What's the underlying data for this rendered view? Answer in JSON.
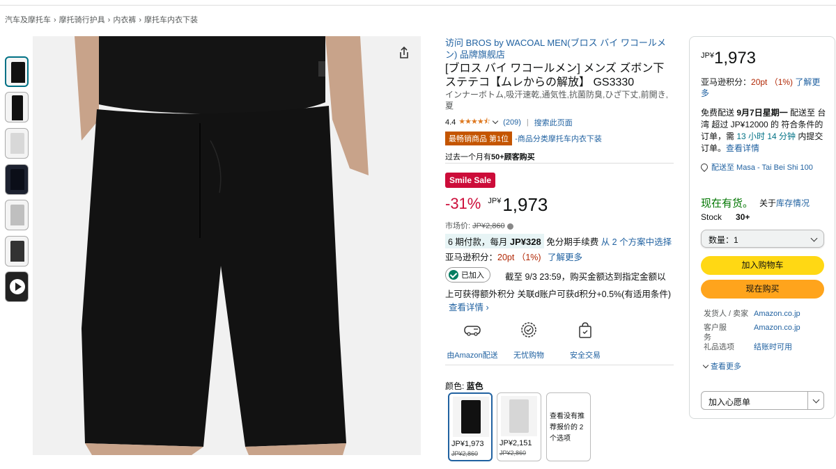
{
  "breadcrumb": [
    "汽车及摩托车",
    "摩托骑行护具",
    "内衣裤",
    "摩托车内衣下装"
  ],
  "breadcrumb_sep": "›",
  "product": {
    "brand_link": "访问 BROS by WACOAL MEN(ブロス バイ ワコールメン) 品牌旗舰店",
    "title": "[ブロス バイ ワコールメン] メンズ ズボン下 ステテコ【ムレからの解放】 GS3330",
    "subtitle": "インナーボトム,吸汗速乾,通気性,抗菌防臭,ひざ下丈,前開き,夏",
    "rating_value": "4.4",
    "stars": "★★★★⯪",
    "rating_count": "(209)",
    "rating_sep": "|",
    "search_page": "搜索此页面",
    "bestseller_badge": "最畅销商品 第1位",
    "bestseller_category": "-商品分类摩托车内衣下装",
    "bought_prefix": "过去一个月有",
    "bought_count": "50+",
    "bought_suffix": "顾客购买"
  },
  "pricing": {
    "deal_badge": "Smile Sale",
    "discount": "-31%",
    "currency": "JP¥",
    "price": "1,973",
    "list_price_label": "市场价: ",
    "list_price": "JP¥2,860",
    "installment_part1": "6 期付款，每月 ",
    "installment_amount": "JP¥328",
    "installment_part2": " 免分期手续费 ",
    "installment_link": "从 2 个方案中选择",
    "points_label": "亚马逊积分：",
    "points_value": "20pt （1%)",
    "points_link": "了解更多",
    "joined_label": "已加入",
    "promo_line1": "截至 9/3 23:59，购买金额达到指定金额以",
    "promo_line2": "上可获得额外积分 关联d账户可获d积分+0.5%(有适用条件)",
    "promo_link": "查看详情 ›"
  },
  "features": [
    {
      "label": "由Amazon配送",
      "icon": "delivery-truck-icon"
    },
    {
      "label": "无忧购物",
      "icon": "badge-check-icon"
    },
    {
      "label": "安全交易",
      "icon": "secure-bag-icon"
    }
  ],
  "color": {
    "label": "颜色: ",
    "selected": "蓝色",
    "options": [
      {
        "price": "JP¥1,973",
        "list_price": "JP¥2,860",
        "swatch": "#111111"
      },
      {
        "price": "JP¥2,151",
        "list_price": "JP¥2,860",
        "swatch": "#d6d6d6"
      }
    ],
    "more_options": "查看没有推荐报价的 2 个选项"
  },
  "buybox": {
    "currency": "JP¥",
    "price": "1,973",
    "points_label": "亚马逊积分：",
    "points_value": "20pt （1%)",
    "points_link": "了解更多",
    "delivery_pre": "免费配送 ",
    "delivery_date": "9月7日星期一",
    "delivery_mid": " 配送至 台湾 超过 JP¥12000 的 符合条件的订单，需 ",
    "delivery_countdown": "13 小时 14 分钟",
    "delivery_post": " 内提交订单。",
    "delivery_link": "查看详情",
    "location": "配送至 Masa - Tai Bei Shi 100",
    "stock_status": "现在有货。",
    "stock_link_pre": "关于",
    "stock_link": "库存情况",
    "stock_label": "Stock",
    "stock_count": "30+",
    "qty_label": "数量：",
    "qty_value": "1",
    "add_to_cart": "加入购物车",
    "buy_now": "现在购买",
    "seller_rows": [
      {
        "label": "发货人 / 卖家",
        "value": "Amazon.co.jp"
      },
      {
        "label": "客户服务",
        "value": "Amazon.co.jp"
      },
      {
        "label": "礼品选项",
        "value": "结账时可用"
      }
    ],
    "see_more": "查看更多",
    "wishlist": "加入心愿单"
  },
  "colors": {
    "accent_link": "#2162a1",
    "deal_red": "#cc0c39",
    "cart_yellow": "#ffd814",
    "buy_orange": "#ffa41c",
    "in_stock_green": "#007600"
  }
}
